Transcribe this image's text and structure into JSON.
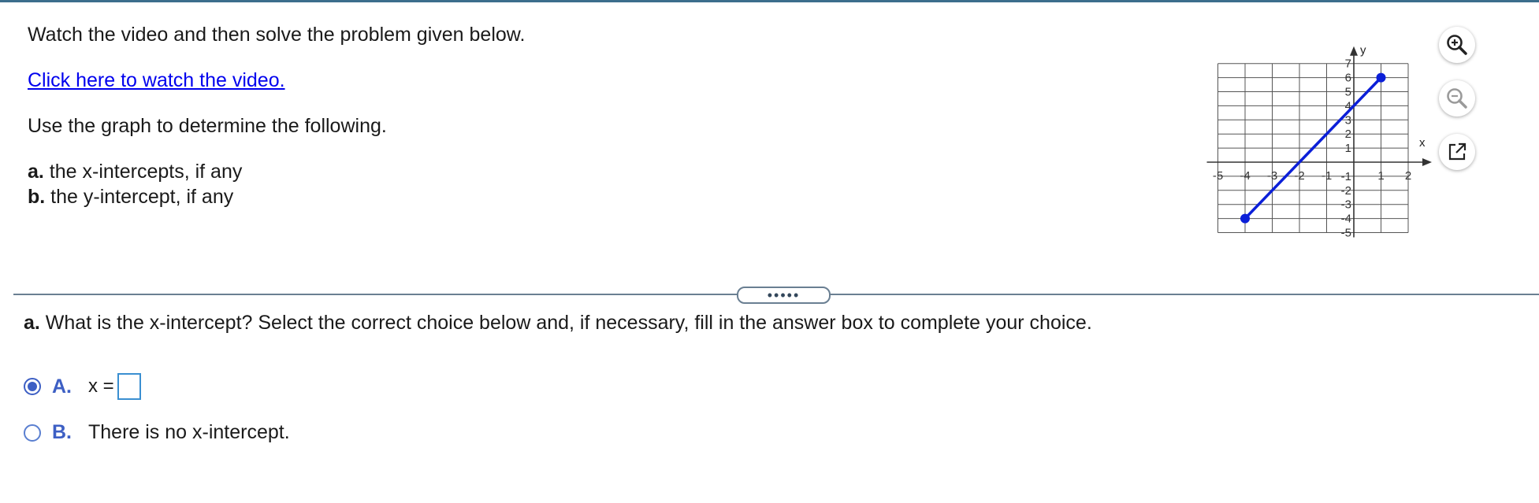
{
  "question": {
    "instruction": "Watch the video and then solve the problem given below.",
    "video_link": "Click here to watch the video.",
    "use_graph": "Use the graph to determine the following.",
    "parts": [
      {
        "letter": "a.",
        "text": " the x-intercepts, if any"
      },
      {
        "letter": "b.",
        "text": " the y-intercept, if any"
      }
    ]
  },
  "graph": {
    "x_label": "x",
    "y_label": "y",
    "x_ticks": [
      "-5",
      "-4",
      "-3",
      "-2",
      "-1",
      "1",
      "2"
    ],
    "y_ticks": [
      "7",
      "6",
      "5",
      "4",
      "3",
      "2",
      "1",
      "-1",
      "-2",
      "-3",
      "-4",
      "-5"
    ],
    "x_range": [
      -5,
      2
    ],
    "y_range": [
      -5,
      7
    ],
    "line_color": "#0b1fd8",
    "segment": {
      "start": [
        -4,
        -4
      ],
      "end": [
        1,
        6
      ]
    }
  },
  "toolbar": {
    "zoom_in_icon": "zoom-in-icon",
    "zoom_out_icon": "zoom-out-icon",
    "popout_icon": "external-window-icon"
  },
  "divider": {
    "handle_label": "•••••"
  },
  "part_a": {
    "letter": "a.",
    "text": " What is the x-intercept? Select the correct choice below and, if necessary, fill in the answer box to complete your choice."
  },
  "choices": [
    {
      "letter": "A.",
      "prefix": "x =",
      "selected": true
    },
    {
      "letter": "B.",
      "text": "There is no x-intercept.",
      "selected": false
    }
  ],
  "colors": {
    "accent": "#3d5fc4",
    "link": "#0000ee",
    "answer_border": "#3a8fd1"
  }
}
